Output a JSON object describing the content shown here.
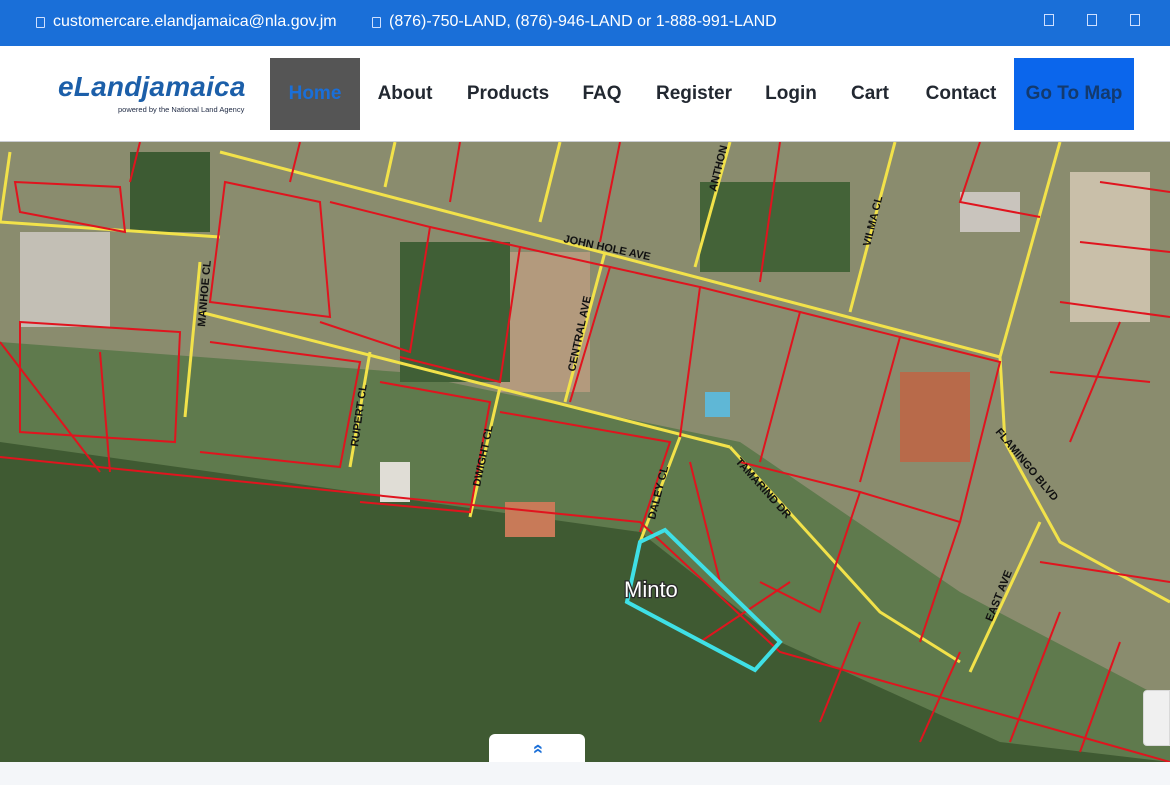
{
  "topbar": {
    "email": "customercare.elandjamaica@nla.gov.jm",
    "phone": "(876)-750-LAND, (876)-946-LAND or 1-888-991-LAND",
    "email_icon": "envelope-icon",
    "phone_icon": "phone-icon",
    "social_icons": [
      "facebook-icon",
      "twitter-icon",
      "instagram-icon"
    ]
  },
  "logo": {
    "wordmark": "eLandjamaica",
    "tagline": "powered by the National Land Agency"
  },
  "nav": {
    "items": [
      {
        "label": "Home",
        "active": true
      },
      {
        "label": "About"
      },
      {
        "label": "Products"
      },
      {
        "label": "FAQ"
      },
      {
        "label": "Register"
      },
      {
        "label": "Login"
      },
      {
        "label": "Cart"
      },
      {
        "label": "Contact"
      },
      {
        "label": "Go To Map"
      }
    ]
  },
  "map": {
    "streets": [
      "JOHN HOLE AVE",
      "MANHOE CL",
      "CENTRAL AVE",
      "RUPERT CL",
      "DWIGHT CL",
      "DALEY CL",
      "TAMARIND DR",
      "VILMA CL",
      "ANTHON",
      "FLAMINGO BLVD",
      "EAST AVE"
    ],
    "parcel_label": "Minto",
    "colors": {
      "parcel_lines": "#e0141e",
      "roads": "#f2e24a",
      "selected_parcel": "#3fe0e6"
    }
  },
  "scroll_top": {
    "icon": "double-chevron-up-icon",
    "glyph": "»"
  },
  "colors": {
    "topbar": "#1a6fd8",
    "accent": "#0b66ec",
    "home_active_bg": "#555555"
  }
}
